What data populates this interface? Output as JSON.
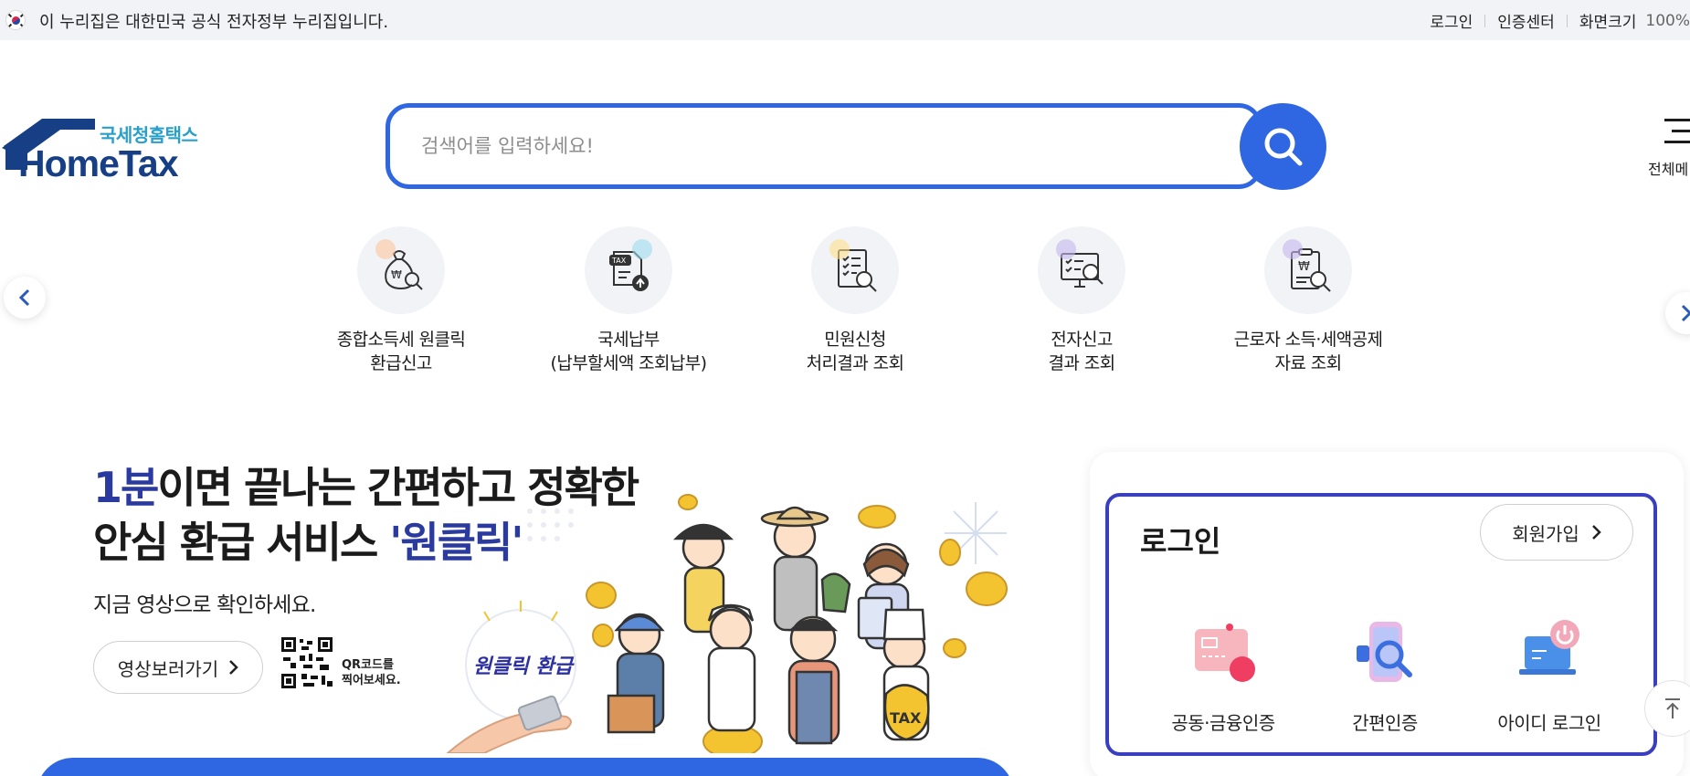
{
  "gov_bar": {
    "notice": "이 누리집은 대한민국 공식 전자정부 누리집입니다.",
    "links": [
      "로그인",
      "인증센터",
      "화면크기"
    ],
    "zoom": "100%"
  },
  "header": {
    "logo_sub": "국세청홈택스",
    "logo_main": "HomeTax",
    "search_placeholder": "검색어를 입력하세요!",
    "all_menu_label": "전체메"
  },
  "quick_menu": [
    {
      "line1": "종합소득세 원클릭",
      "line2": "환급신고",
      "icon": "money-bag-search-icon"
    },
    {
      "line1": "국세납부",
      "line2": "(납부할세액 조회납부)",
      "icon": "tax-document-upload-icon"
    },
    {
      "line1": "민원신청",
      "line2": "처리결과 조회",
      "icon": "checklist-search-icon"
    },
    {
      "line1": "전자신고",
      "line2": "결과 조회",
      "icon": "monitor-search-icon"
    },
    {
      "line1": "근로자 소득·세액공제",
      "line2": "자료 조회",
      "icon": "clipboard-won-search-icon"
    }
  ],
  "banner": {
    "title_hl1": "1분",
    "title_rest1": "이면 끝나는 간편하고 정확한",
    "title_line2": "안심 환급 서비스 ",
    "title_hl2": "'원클릭'",
    "subtitle": "지금 영상으로 확인하세요.",
    "video_button": "영상보러가기",
    "qr_line1": "QR코드를",
    "qr_line2": "찍어보세요.",
    "badge": "원클릭 환급",
    "bag_label": "TAX"
  },
  "login": {
    "title": "로그인",
    "join_button": "회원가입",
    "options": [
      {
        "label": "공동·금융인증",
        "icon": "certificate-card-icon"
      },
      {
        "label": "간편인증",
        "icon": "phone-search-icon"
      },
      {
        "label": "아이디 로그인",
        "icon": "laptop-power-icon"
      }
    ]
  },
  "colors": {
    "primary": "#2e67e1",
    "navy": "#173f86",
    "logo_accent": "#29a0c9",
    "login_border": "#3a3fbf",
    "highlight_text": "#2b3a9e"
  }
}
